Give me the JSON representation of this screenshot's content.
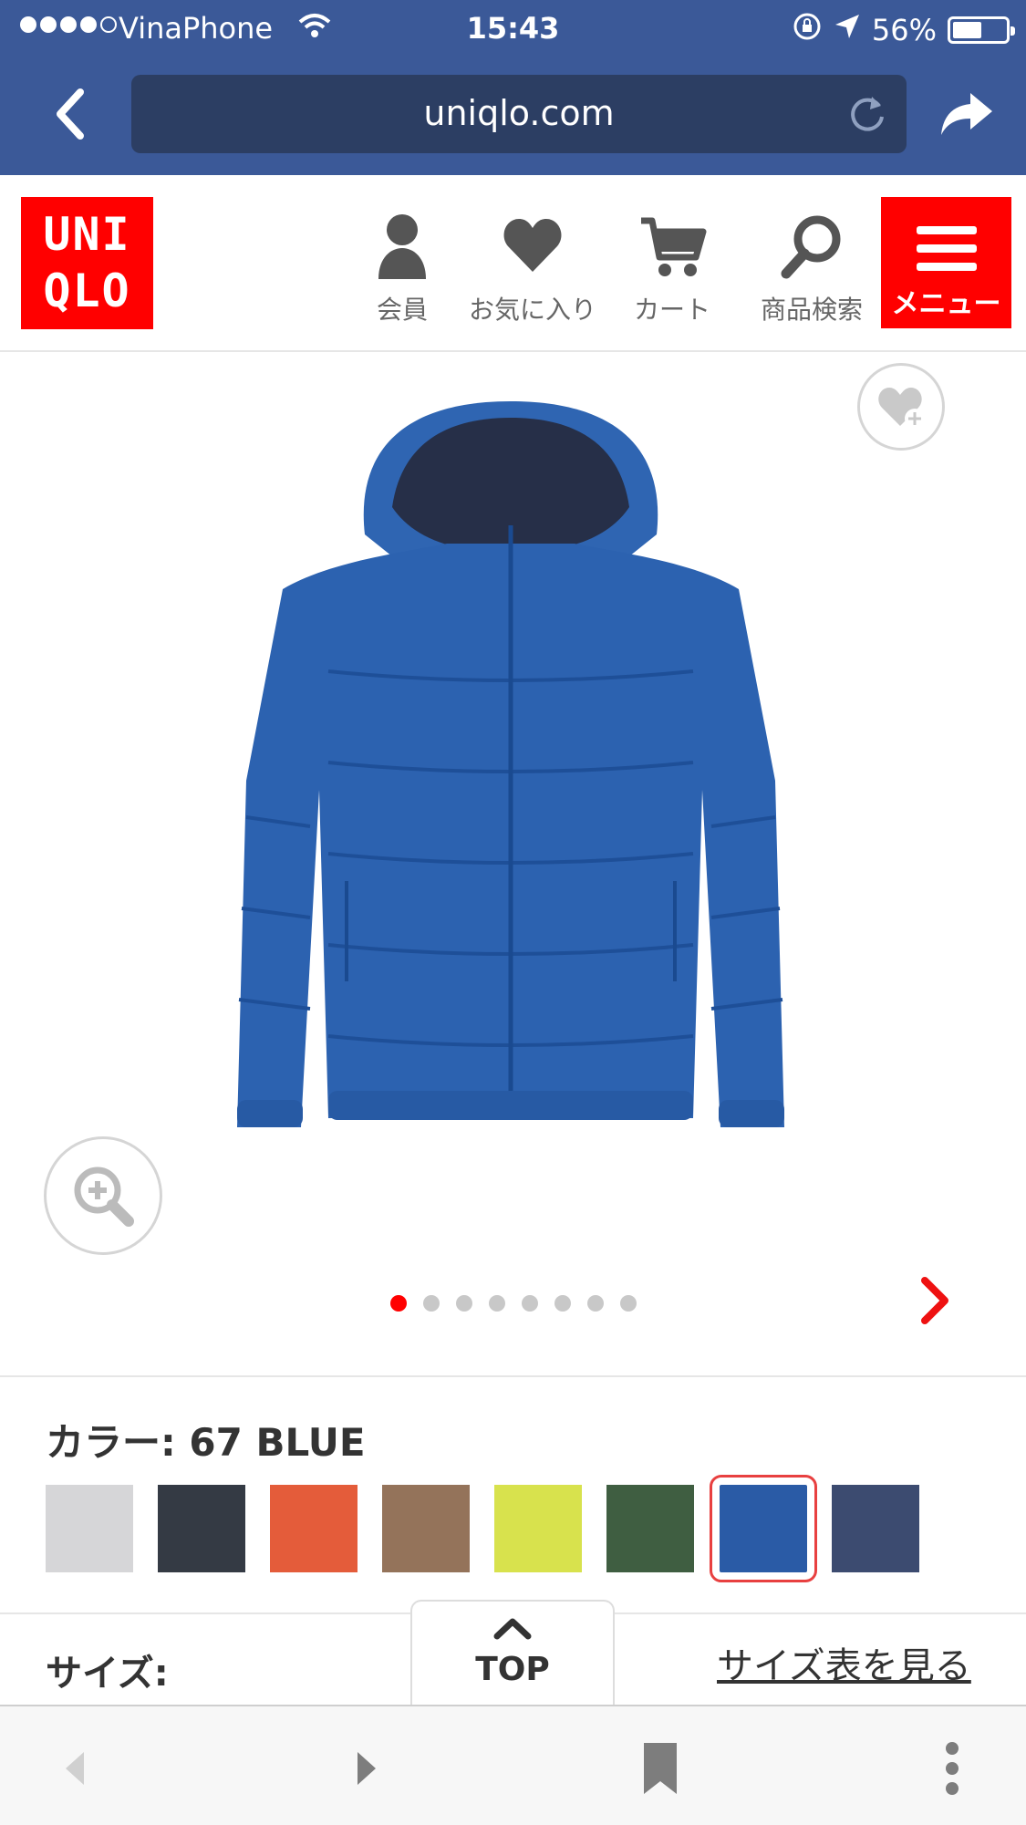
{
  "status_bar": {
    "carrier": "VinaPhone",
    "time": "15:43",
    "battery": "56%",
    "battery_level": 0.56,
    "signal_bars": 4
  },
  "browser": {
    "url": "uniqlo.com",
    "icons": [
      "back-chevron-icon",
      "reload-icon",
      "share-icon"
    ]
  },
  "header": {
    "logo_line1": "UNI",
    "logo_line2": "QLO",
    "nav": [
      {
        "label": "会員",
        "icon": "person-icon"
      },
      {
        "label": "お気に入り",
        "icon": "heart-icon"
      },
      {
        "label": "カート",
        "icon": "cart-icon"
      },
      {
        "label": "商品検索",
        "icon": "search-icon"
      }
    ],
    "menu_label": "メニュー",
    "brand_color": "#ff0000"
  },
  "product": {
    "image_count": 8,
    "active_image_index": 0,
    "favorite_icon": "heart-plus-icon",
    "zoom_icon": "zoom-in-icon",
    "next_icon": "chevron-right-icon"
  },
  "color": {
    "label": "カラー: 67 BLUE",
    "selected_index": 6,
    "swatches": [
      {
        "hex": "#d6d6d8"
      },
      {
        "hex": "#343a44"
      },
      {
        "hex": "#e45c3a"
      },
      {
        "hex": "#94735a"
      },
      {
        "hex": "#d8e24d"
      },
      {
        "hex": "#3f5e41"
      },
      {
        "hex": "#2a5ba6"
      },
      {
        "hex": "#3c4b70"
      }
    ]
  },
  "size": {
    "label": "サイズ:",
    "chart_link": "サイズ表を見る"
  },
  "top_button": {
    "label": "TOP"
  },
  "toolbar": {
    "icons": [
      "back-icon",
      "forward-icon",
      "bookmark-icon",
      "more-icon"
    ]
  }
}
